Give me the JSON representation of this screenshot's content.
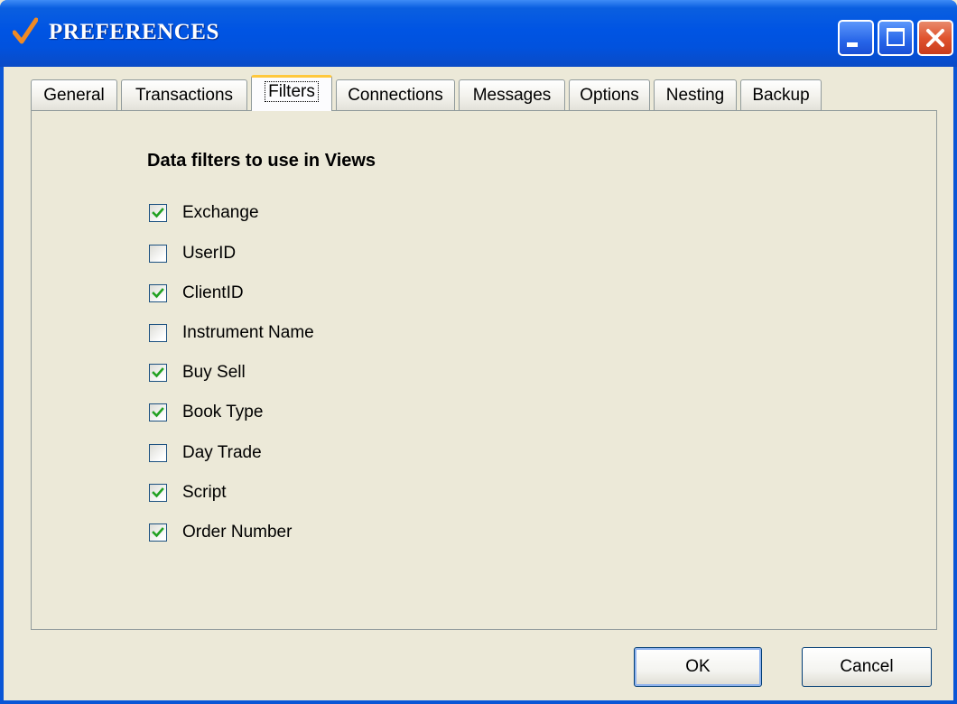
{
  "window": {
    "title": "PREFERENCES",
    "accent": "#0054e3",
    "controls": [
      "minimize-icon",
      "maximize-icon",
      "close-icon"
    ]
  },
  "tabs": [
    {
      "label": "General"
    },
    {
      "label": "Transactions"
    },
    {
      "label": "Filters",
      "selected": true
    },
    {
      "label": "Connections"
    },
    {
      "label": "Messages"
    },
    {
      "label": "Options"
    },
    {
      "label": "Nesting"
    },
    {
      "label": "Backup"
    }
  ],
  "filters": {
    "heading": "Data filters to use in Views",
    "items": [
      {
        "label": "Exchange",
        "checked": true
      },
      {
        "label": "UserID",
        "checked": false
      },
      {
        "label": "ClientID",
        "checked": true
      },
      {
        "label": "Instrument Name",
        "checked": false
      },
      {
        "label": "Buy Sell",
        "checked": true
      },
      {
        "label": "Book Type",
        "checked": true
      },
      {
        "label": "Day Trade",
        "checked": false
      },
      {
        "label": "Script",
        "checked": true
      },
      {
        "label": "Order Number",
        "checked": true
      }
    ]
  },
  "buttons": {
    "ok": "OK",
    "cancel": "Cancel"
  }
}
